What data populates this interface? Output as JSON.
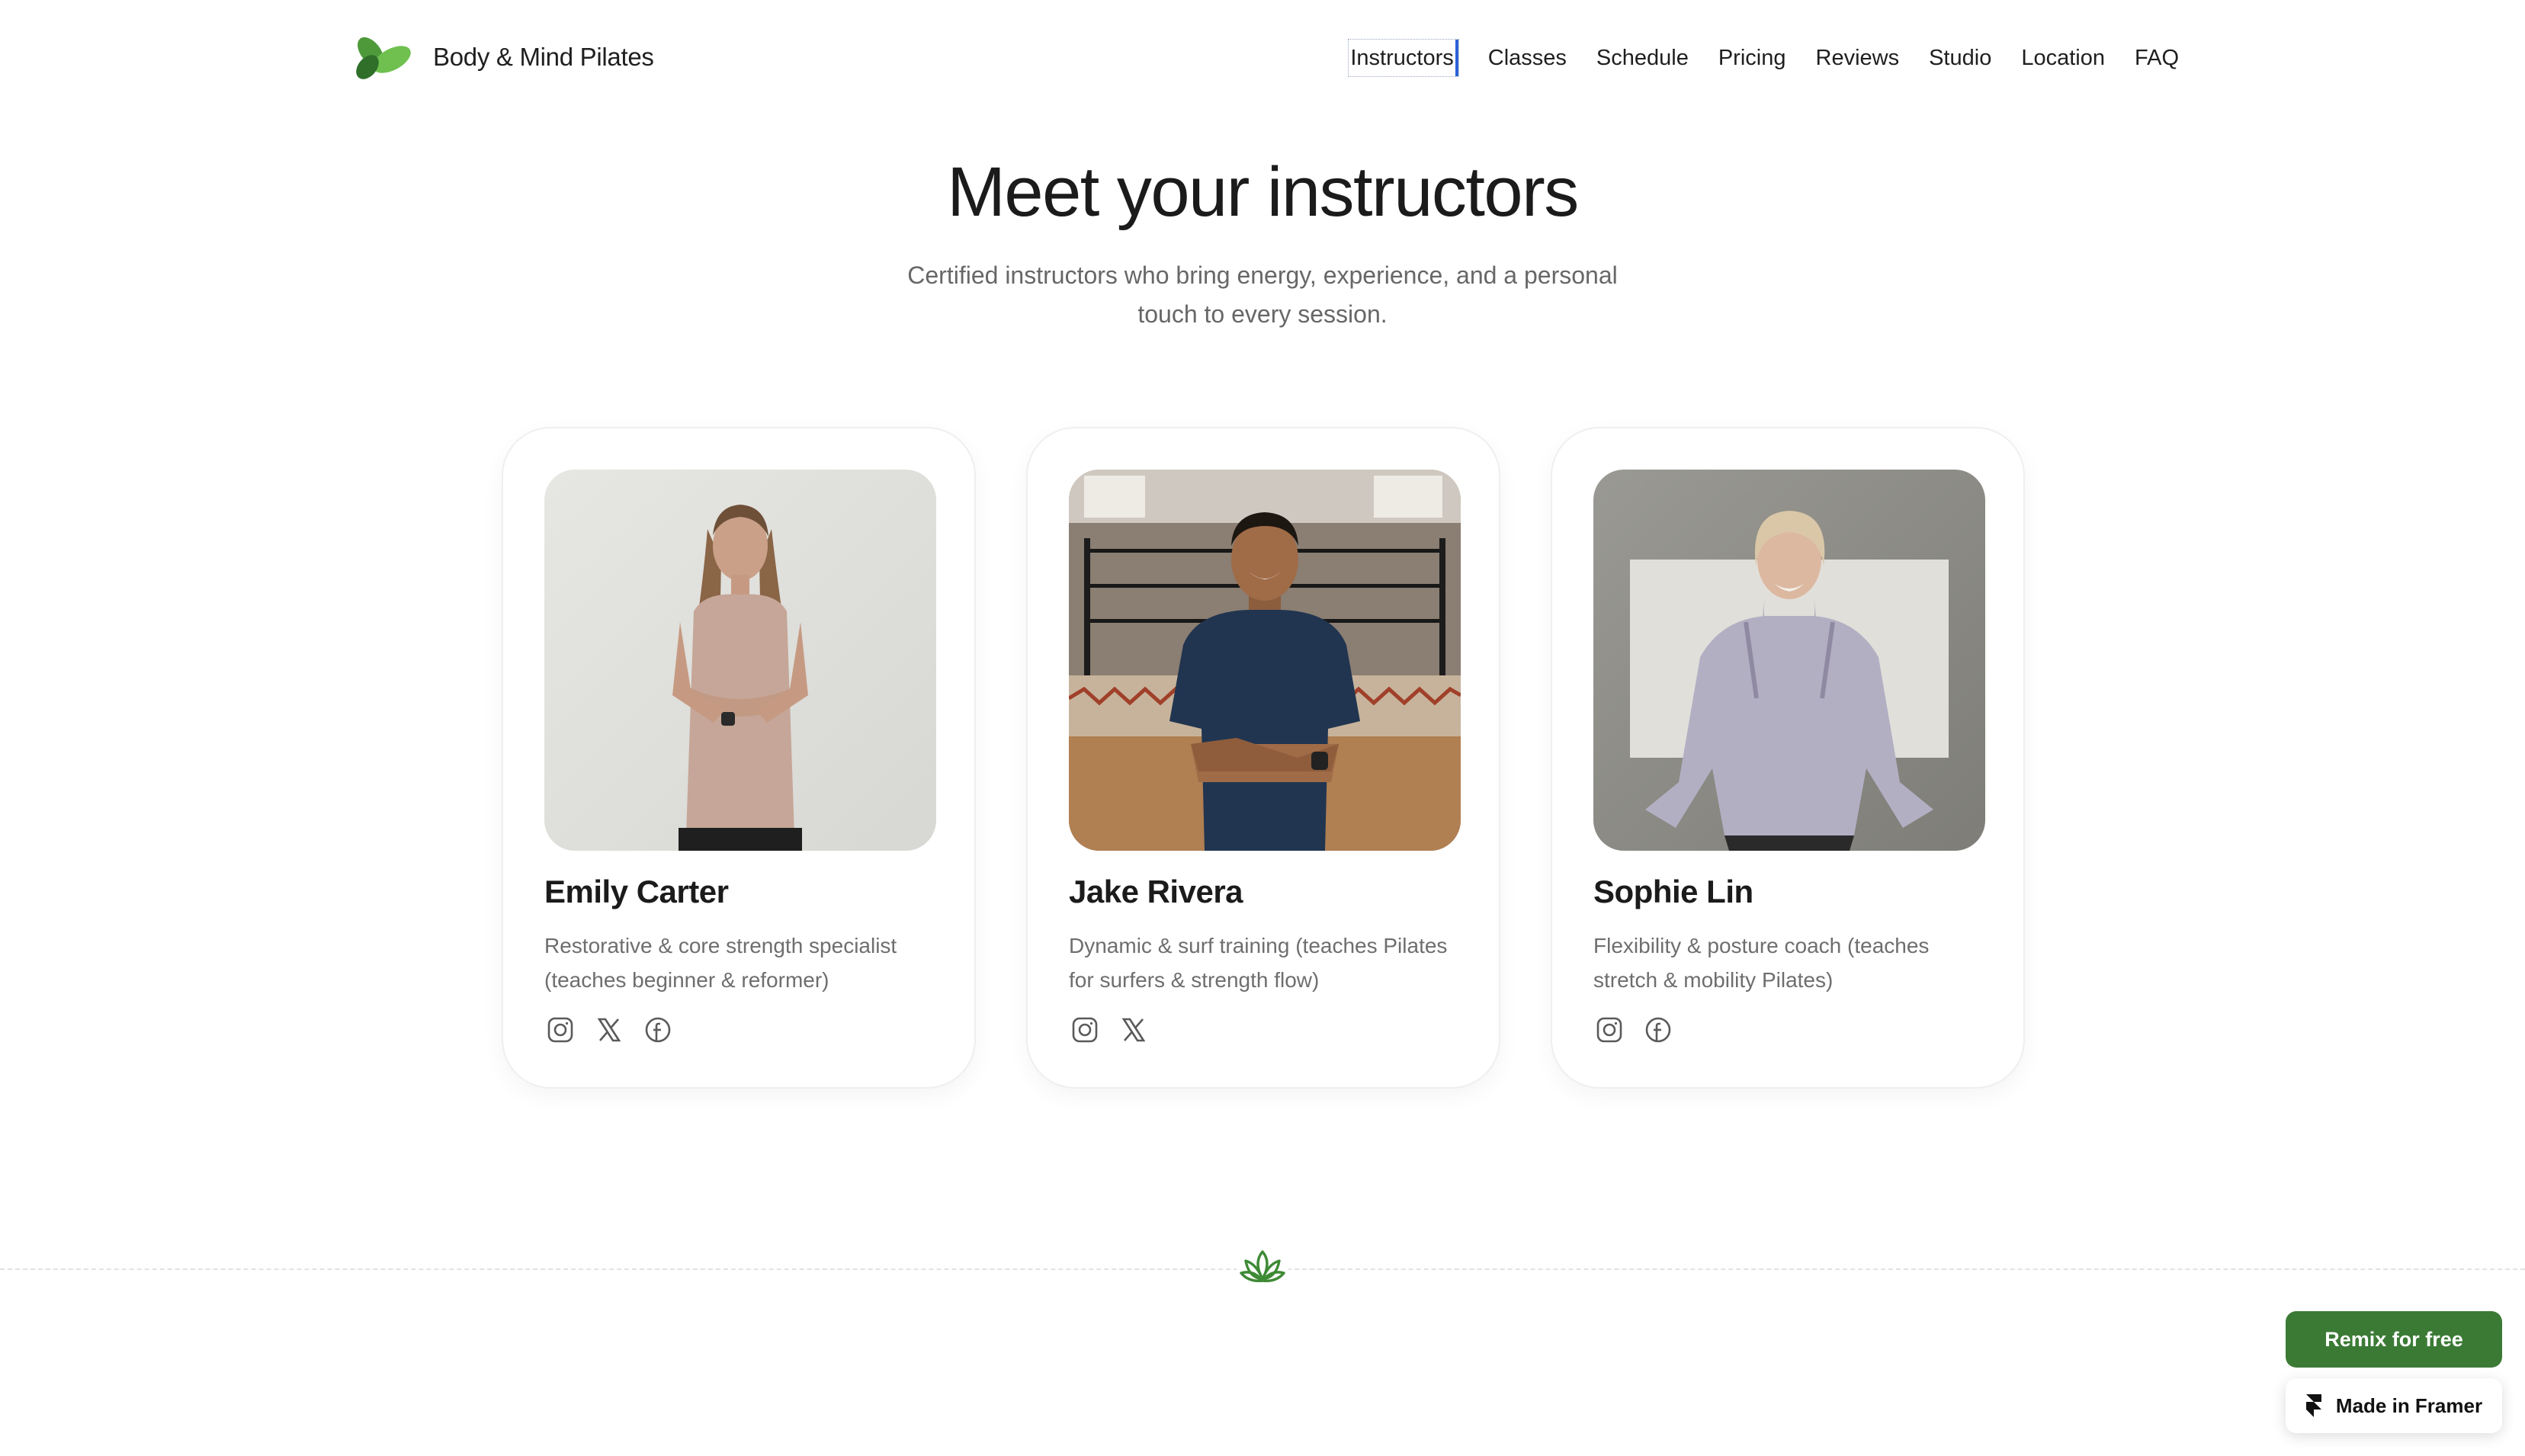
{
  "brand": {
    "name": "Body & Mind Pilates",
    "logo_icon": "leaf-icon"
  },
  "nav": {
    "items": [
      {
        "label": "Instructors",
        "active": true
      },
      {
        "label": "Classes"
      },
      {
        "label": "Schedule"
      },
      {
        "label": "Pricing"
      },
      {
        "label": "Reviews"
      },
      {
        "label": "Studio"
      },
      {
        "label": "Location"
      },
      {
        "label": "FAQ"
      }
    ]
  },
  "hero": {
    "title": "Meet your instructors",
    "subtitle": "Certified instructors who bring energy, experience, and a personal touch to every session."
  },
  "instructors": [
    {
      "name": "Emily Carter",
      "role": "Restorative & core strength specialist (teaches beginner & reformer)",
      "socials": [
        "instagram-icon",
        "x-icon",
        "facebook-icon"
      ]
    },
    {
      "name": "Jake Rivera",
      "role": "Dynamic & surf training (teaches Pilates for surfers & strength flow)",
      "socials": [
        "instagram-icon",
        "x-icon"
      ]
    },
    {
      "name": "Sophie Lin",
      "role": "Flexibility & posture coach (teaches stretch & mobility Pilates)",
      "socials": [
        "instagram-icon",
        "facebook-icon"
      ]
    }
  ],
  "divider_icon": "lotus-icon",
  "floating": {
    "remix_label": "Remix for free",
    "framer_label": "Made in Framer",
    "framer_icon": "framer-icon"
  },
  "colors": {
    "accent_green": "#3b7a35",
    "text_dark": "#1b1b1b",
    "text_muted": "#6e6e6e",
    "focus_blue": "#2a62d8"
  }
}
